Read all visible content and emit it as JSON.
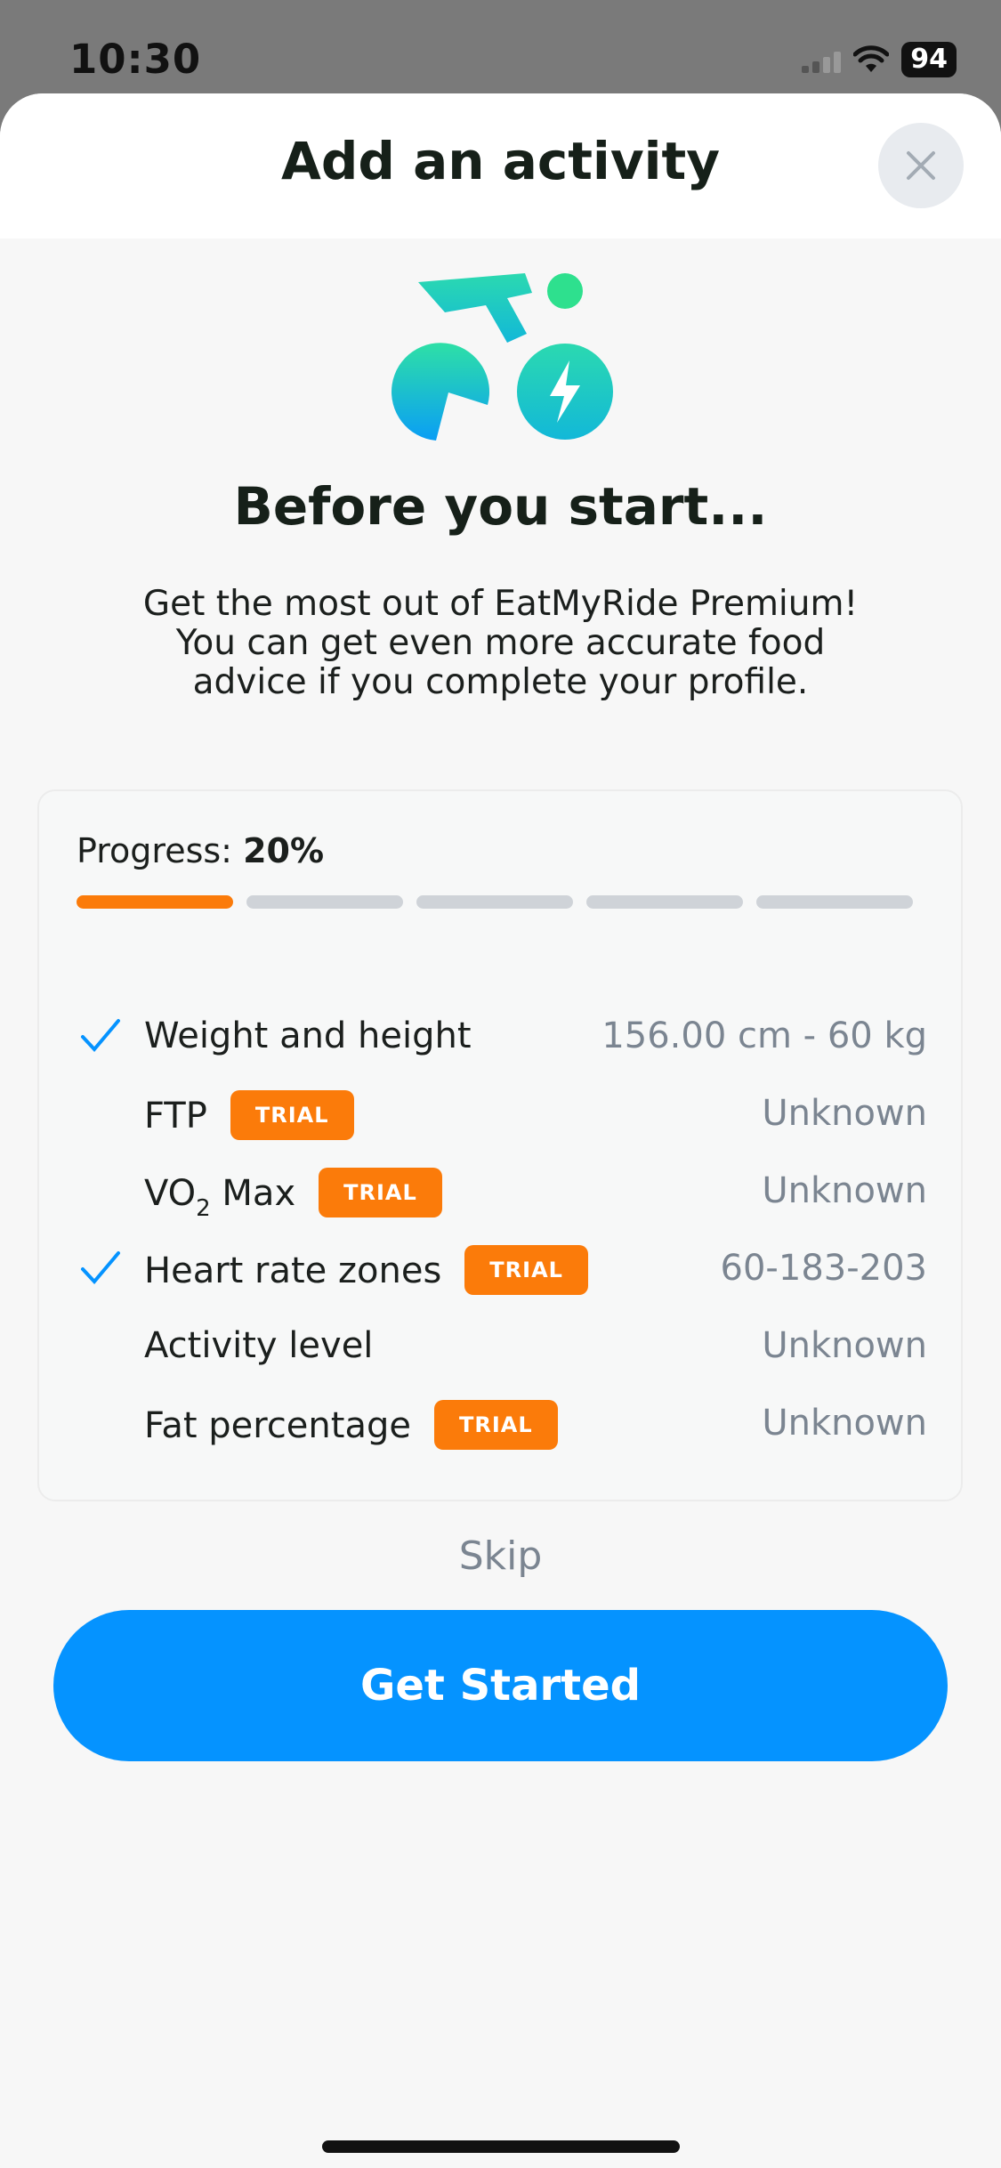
{
  "status_bar": {
    "time": "10:30",
    "battery": "94"
  },
  "sheet": {
    "title": "Add an activity",
    "close_icon": "close-icon",
    "heading": "Before you start...",
    "description": "Get the most out of EatMyRide Premium! You can get even more accurate food advice if you complete your profile."
  },
  "progress": {
    "label": "Progress:",
    "value_text": "20%",
    "percent": 20,
    "segments_total": 5,
    "segments_done": 1
  },
  "profile_items": [
    {
      "label": "Weight and height",
      "value": "156.00 cm - 60 kg",
      "checked": true,
      "trial": false
    },
    {
      "label": "FTP",
      "value": "Unknown",
      "checked": false,
      "trial": true
    },
    {
      "label": "VO",
      "label_sub": "2",
      "label_suffix": " Max",
      "value": "Unknown",
      "checked": false,
      "trial": true
    },
    {
      "label": "Heart rate zones",
      "value": "60-183-203",
      "checked": true,
      "trial": true
    },
    {
      "label": "Activity level",
      "value": "Unknown",
      "checked": false,
      "trial": false
    },
    {
      "label": "Fat percentage",
      "value": "Unknown",
      "checked": false,
      "trial": true
    }
  ],
  "trial_badge": "TRIAL",
  "actions": {
    "skip": "Skip",
    "get_started": "Get Started"
  },
  "colors": {
    "accent": "#0593ff",
    "trial": "#fb7b0a",
    "check": "#0593ff",
    "logo_teal": "#2ed3b7"
  }
}
